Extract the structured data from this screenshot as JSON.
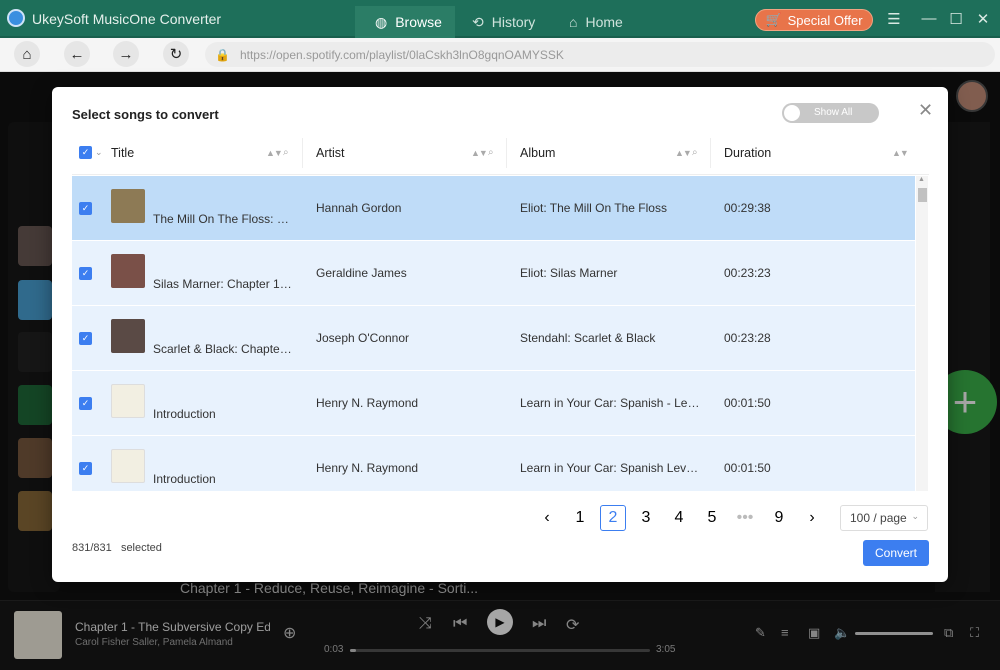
{
  "app": {
    "title": "UkeySoft MusicOne Converter",
    "tabs": [
      {
        "label": "Browse",
        "icon": "globe-icon"
      },
      {
        "label": "History",
        "icon": "history-icon"
      },
      {
        "label": "Home",
        "icon": "home-icon"
      }
    ],
    "special_offer": "Special Offer",
    "url": "https://open.spotify.com/playlist/0laCskh3lnO8gqnOAMYSSK"
  },
  "background": {
    "row_title": "Chapter 1 - Reduce, Reuse, Reimagine - Sorti..."
  },
  "player": {
    "track_title": "Chapter 1 - The Subversive Copy Edito",
    "track_artist": "Carol Fisher Saller, Pamela Almand",
    "elapsed": "0:03",
    "duration": "3:05",
    "progress": 0.02
  },
  "dialog": {
    "title": "Select songs to convert",
    "show_all_label": "Show All",
    "columns": {
      "title": "Title",
      "artist": "Artist",
      "album": "Album",
      "duration": "Duration"
    },
    "rows": [
      {
        "title": "The Mill On The Floss: C...",
        "artist": "Hannah Gordon",
        "album": "Eliot: The Mill On The Floss",
        "duration": "00:29:38",
        "checked": true,
        "highlighted": true
      },
      {
        "title": "Silas Marner: Chapter 1, ...",
        "artist": "Geraldine James",
        "album": "Eliot: Silas Marner",
        "duration": "00:23:23",
        "checked": true,
        "highlighted": false
      },
      {
        "title": "Scarlet & Black: Chapter ...",
        "artist": "Joseph O'Connor",
        "album": "Stendahl: Scarlet & Black",
        "duration": "00:23:28",
        "checked": true,
        "highlighted": false
      },
      {
        "title": "Introduction",
        "artist": "Henry N. Raymond",
        "album": "Learn in Your Car: Spanish - Leve...",
        "duration": "00:01:50",
        "checked": true,
        "highlighted": false
      },
      {
        "title": "Introduction",
        "artist": "Henry N. Raymond",
        "album": "Learn in Your Car: Spanish Level 2",
        "duration": "00:01:50",
        "checked": true,
        "highlighted": false
      }
    ],
    "pagination": {
      "pages": [
        "1",
        "2",
        "3",
        "4",
        "5",
        "•••",
        "9"
      ],
      "current": "2",
      "per_page": "100 / page"
    },
    "selected_count": "831/831",
    "selected_label": "selected",
    "convert_label": "Convert"
  },
  "colors": {
    "accent": "#3c7ef0",
    "titlebar": "#1e6f5a",
    "row_bg": "#e8f2fd",
    "row_selected": "#bfdcf8"
  }
}
